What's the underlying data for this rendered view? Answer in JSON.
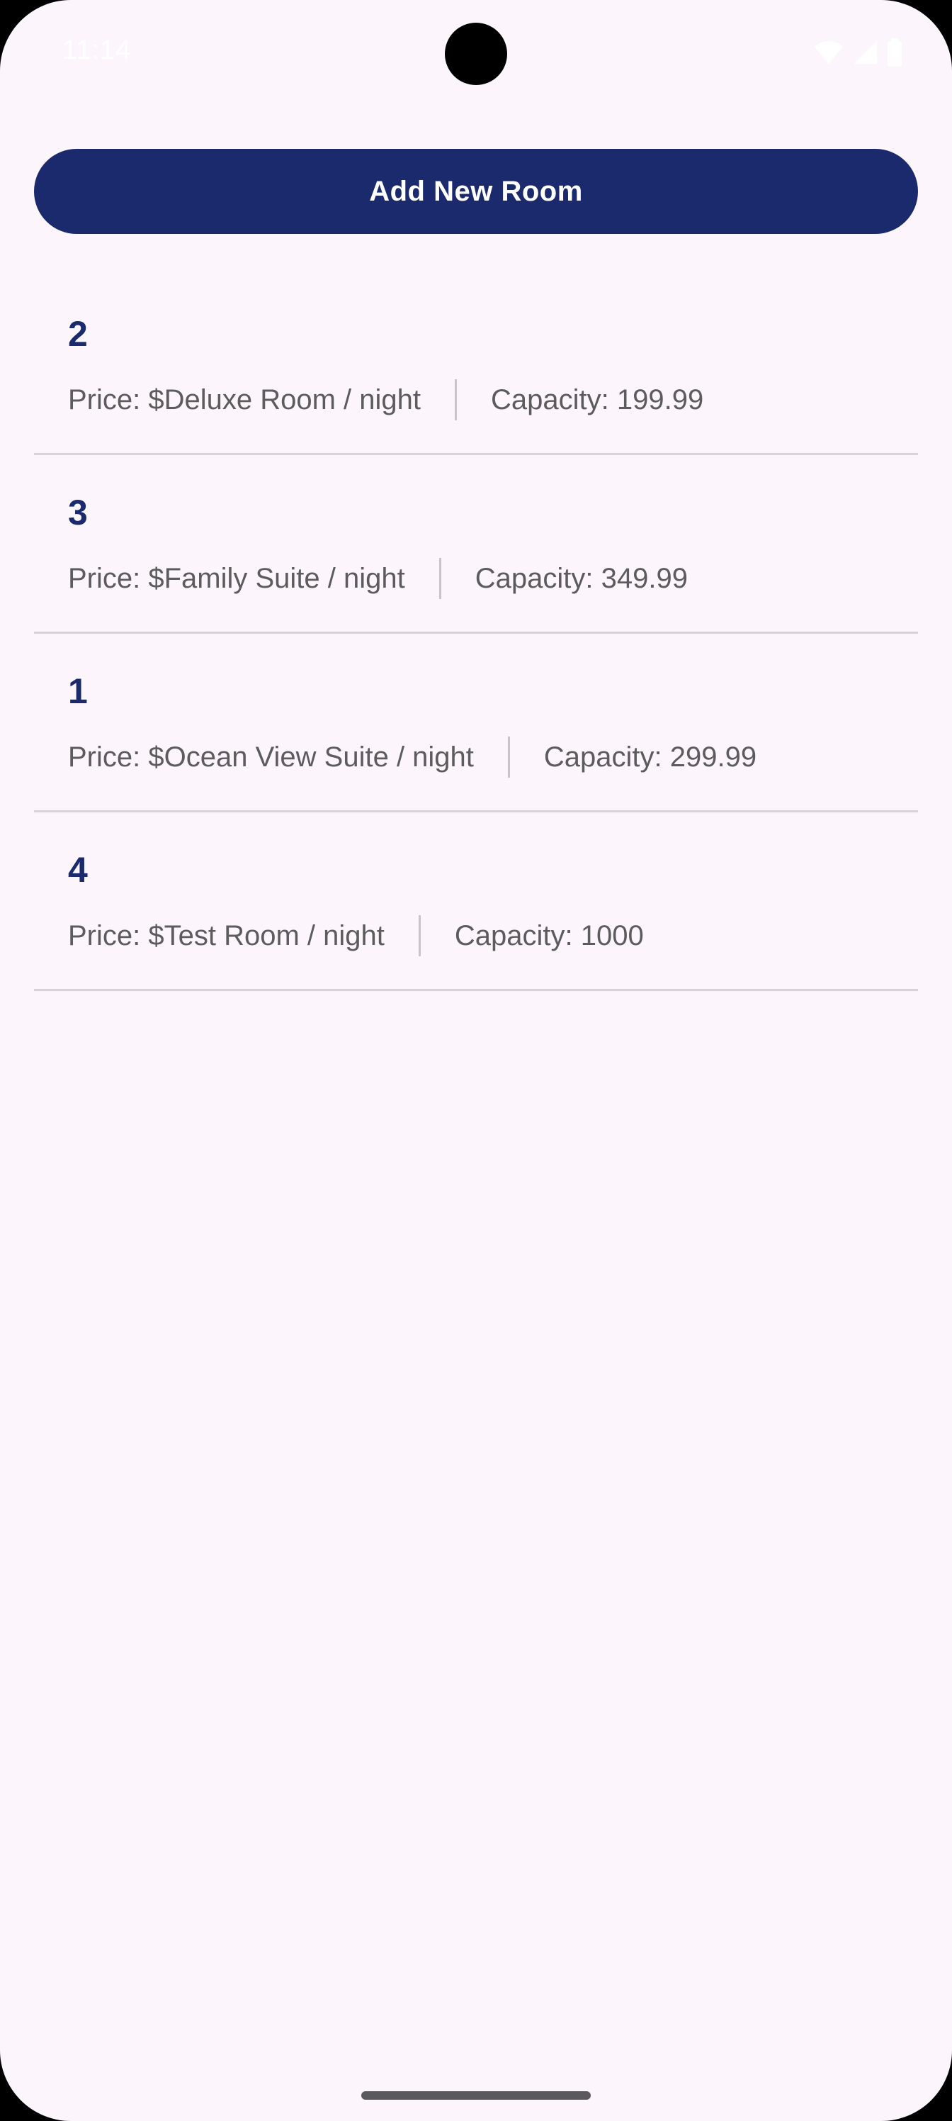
{
  "status_bar": {
    "time": "11:14",
    "icons": [
      "wifi-icon",
      "signal-icon",
      "battery-icon"
    ]
  },
  "actions": {
    "add_room_label": "Add New Room"
  },
  "rooms": [
    {
      "id": "2",
      "price": "Price: $Deluxe Room / night",
      "capacity": "Capacity: 199.99"
    },
    {
      "id": "3",
      "price": "Price: $Family Suite / night",
      "capacity": "Capacity: 349.99"
    },
    {
      "id": "1",
      "price": "Price: $Ocean View Suite / night",
      "capacity": "Capacity: 299.99"
    },
    {
      "id": "4",
      "price": "Price: $Test Room / night",
      "capacity": "Capacity: 1000"
    }
  ],
  "colors": {
    "primary": "#1b2a6d",
    "background": "#fcf6fc",
    "secondary_text": "#5c5c5c",
    "divider": "#d6d2d8"
  }
}
